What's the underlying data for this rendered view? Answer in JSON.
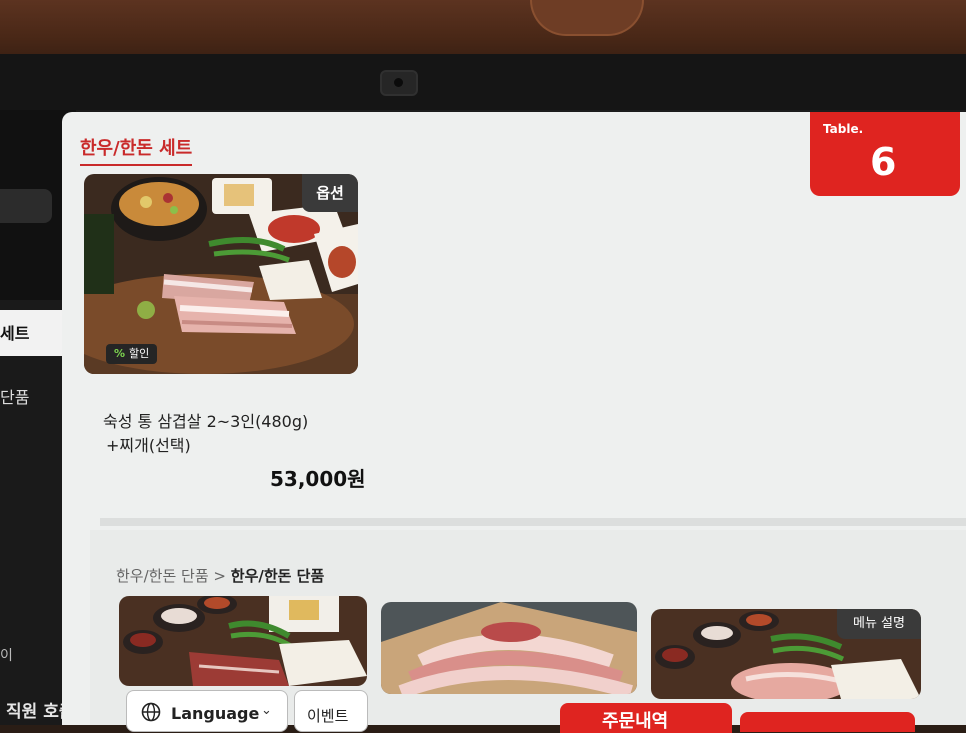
{
  "sidebar": {
    "items": [
      {
        "label": "세트"
      },
      {
        "label": "단품"
      }
    ],
    "fragment_label": "이",
    "call_staff_label": "직원 호출"
  },
  "header": {
    "section_title": "한우/한돈 세트",
    "table_badge_label": "Table.",
    "table_number": "6"
  },
  "featured_product": {
    "option_badge": "옵션",
    "discount_icon": "%",
    "discount_label": "할인",
    "name_line1": "숙성 통 삼겹살 2~3인(480g)",
    "name_line2": "+찌개(선택)",
    "price": "53,000원"
  },
  "breadcrumb": {
    "parent": "한우/한돈 단품",
    "separator": ">",
    "current": "한우/한돈 단품"
  },
  "menu_grid": {
    "third_item_badge": "메뉴 설명"
  },
  "bottom_bar": {
    "language_label": "Language",
    "language_chevron": "⌄",
    "event_label": "이벤트",
    "order_label": "주문내역"
  },
  "colors": {
    "accent": "#df2420",
    "title_red": "#c92a2a",
    "panel_bg": "#eef0ef"
  }
}
